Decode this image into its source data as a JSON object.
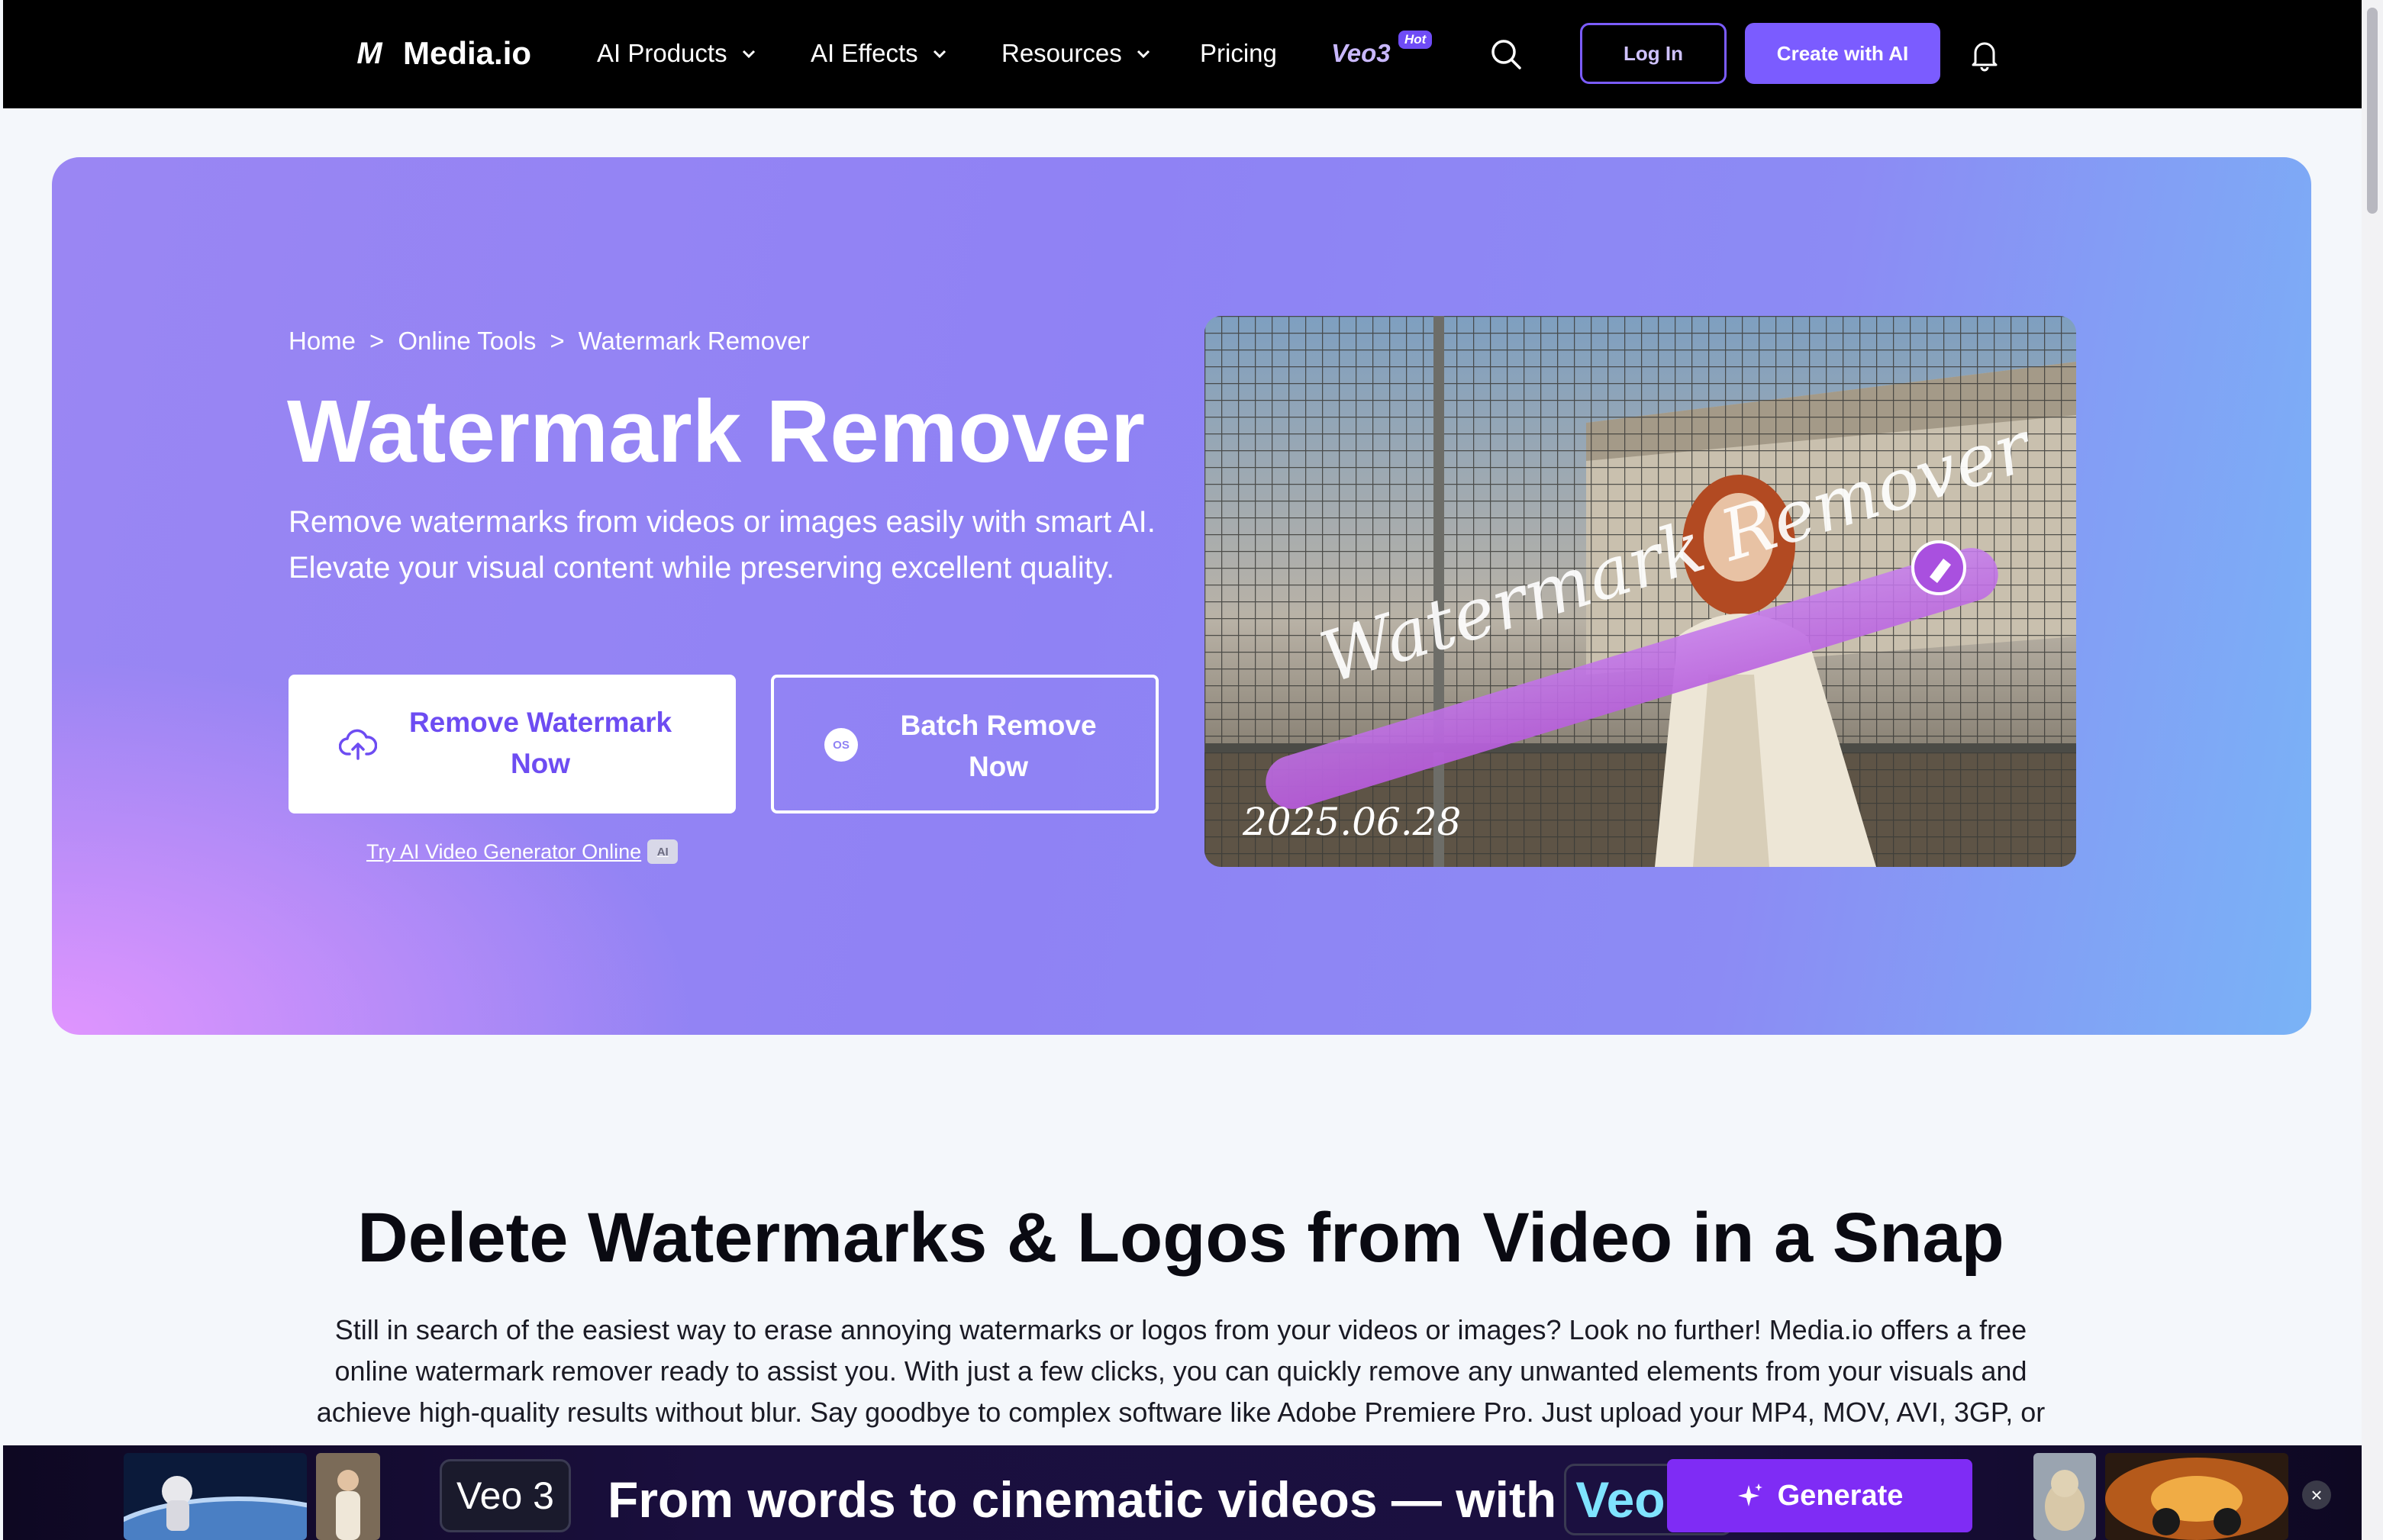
{
  "nav": {
    "brand": "Media.io",
    "brand_mark": "M",
    "items": [
      {
        "label": "AI Products"
      },
      {
        "label": "AI Effects"
      },
      {
        "label": "Resources"
      },
      {
        "label": "Pricing"
      }
    ],
    "veo_label": "Veo3",
    "hot_badge": "Hot",
    "login": "Log In",
    "create": "Create with AI"
  },
  "hero": {
    "breadcrumb": [
      "Home",
      "Online Tools",
      "Watermark Remover"
    ],
    "breadcrumb_sep": ">",
    "title": "Watermark Remover",
    "description": "Remove watermarks from videos or images easily with smart AI. Elevate your visual content while preserving excellent quality.",
    "remove_button": "Remove Watermark Now",
    "batch_button": "Batch Remove Now",
    "os_icon_text": "OS",
    "try_link": "Try AI Video Generator Online",
    "ai_chip": "AI",
    "image_date": "2025.06.28",
    "image_watermark": "Watermark Remover"
  },
  "section": {
    "title": "Delete Watermarks & Logos from Video in a Snap",
    "body": "Still in search of the easiest way to erase annoying watermarks or logos from your videos or images? Look no further! Media.io offers a free online watermark remover ready to assist you. With just a few clicks, you can quickly remove any unwanted elements from your visuals and achieve high-quality results without blur. Say goodbye to complex software like Adobe Premiere Pro. Just upload your MP4, MOV, AVI, 3GP, or"
  },
  "promo": {
    "badge": "Veo 3",
    "text": "From words to cinematic videos — with",
    "veo_chip": "Veo 3.",
    "generate": "Generate",
    "close": "×"
  },
  "colors": {
    "accent": "#7b5cff",
    "nav_bg": "#000000",
    "promo_button": "#7f2cf5"
  }
}
